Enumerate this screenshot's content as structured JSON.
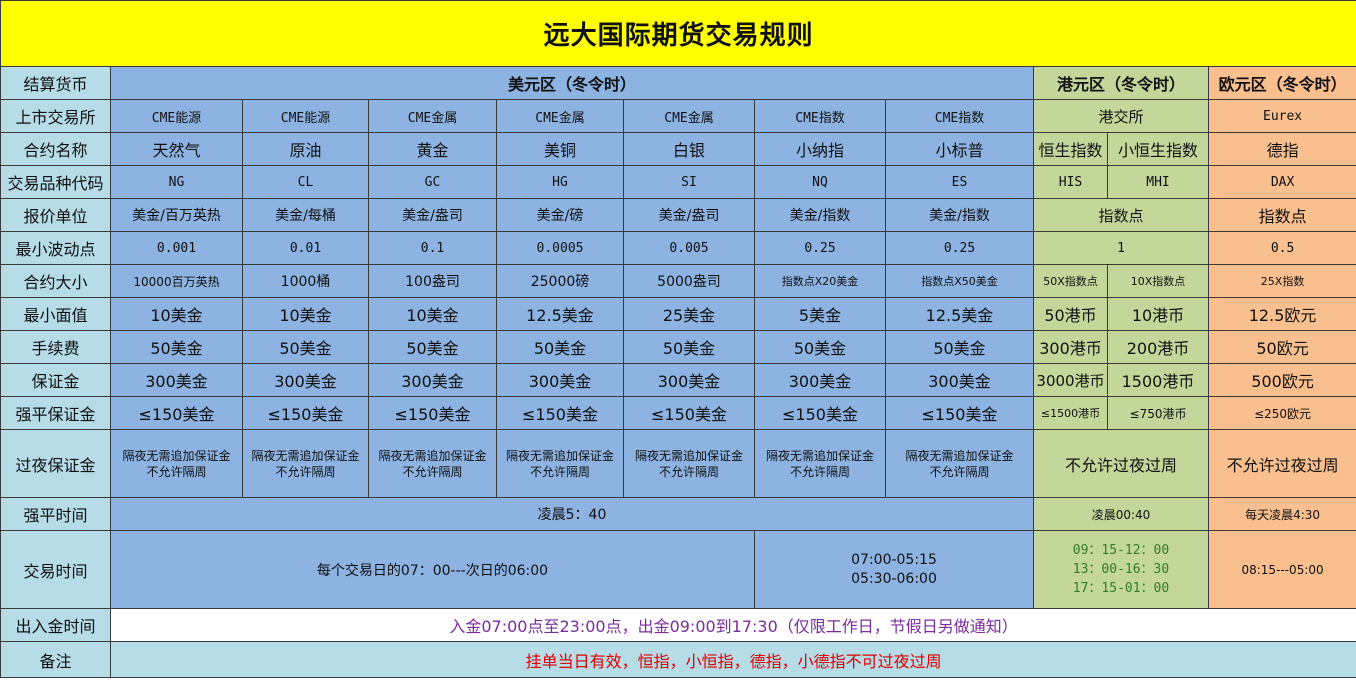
{
  "title": "远大国际期货交易规则",
  "row_labels": {
    "currency": "结算货币",
    "exchange": "上市交易所",
    "name": "合约名称",
    "code": "交易品种代码",
    "quote": "报价单位",
    "tick": "最小波动点",
    "size": "合约大小",
    "face": "最小面值",
    "fee": "手续费",
    "margin": "保证金",
    "forced": "强平保证金",
    "overnight": "过夜保证金",
    "forced_time": "强平时间",
    "trading_time": "交易时间",
    "deposit_time": "出入金时间",
    "remarks": "备注"
  },
  "regions": {
    "usd": "美元区（冬令时）",
    "hkd": "港元区（冬令时）",
    "eur": "欧元区（冬令时）"
  },
  "usd_products": [
    {
      "exchange": "CME能源",
      "name": "天然气",
      "code": "NG",
      "quote": "美金/百万英热",
      "tick": "0.001",
      "size": "10000百万英热",
      "face": "10美金",
      "fee": "50美金",
      "margin": "300美金",
      "forced": "≤150美金",
      "overnight_1": "隔夜无需追加保证金",
      "overnight_2": "不允许隔周"
    },
    {
      "exchange": "CME能源",
      "name": "原油",
      "code": "CL",
      "quote": "美金/每桶",
      "tick": "0.01",
      "size": "1000桶",
      "face": "10美金",
      "fee": "50美金",
      "margin": "300美金",
      "forced": "≤150美金",
      "overnight_1": "隔夜无需追加保证金",
      "overnight_2": "不允许隔周"
    },
    {
      "exchange": "CME金属",
      "name": "黄金",
      "code": "GC",
      "quote": "美金/盎司",
      "tick": "0.1",
      "size": "100盎司",
      "face": "10美金",
      "fee": "50美金",
      "margin": "300美金",
      "forced": "≤150美金",
      "overnight_1": "隔夜无需追加保证金",
      "overnight_2": "不允许隔周"
    },
    {
      "exchange": "CME金属",
      "name": "美铜",
      "code": "HG",
      "quote": "美金/磅",
      "tick": "0.0005",
      "size": "25000磅",
      "face": "12.5美金",
      "fee": "50美金",
      "margin": "300美金",
      "forced": "≤150美金",
      "overnight_1": "隔夜无需追加保证金",
      "overnight_2": "不允许隔周"
    },
    {
      "exchange": "CME金属",
      "name": "白银",
      "code": "SI",
      "quote": "美金/盎司",
      "tick": "0.005",
      "size": "5000盎司",
      "face": "25美金",
      "fee": "50美金",
      "margin": "300美金",
      "forced": "≤150美金",
      "overnight_1": "隔夜无需追加保证金",
      "overnight_2": "不允许隔周"
    },
    {
      "exchange": "CME指数",
      "name": "小纳指",
      "code": "NQ",
      "quote": "美金/指数",
      "tick": "0.25",
      "size": "指数点X20美金",
      "face": "5美金",
      "fee": "50美金",
      "margin": "300美金",
      "forced": "≤150美金",
      "overnight_1": "隔夜无需追加保证金",
      "overnight_2": "不允许隔周"
    },
    {
      "exchange": "CME指数",
      "name": "小标普",
      "code": "ES",
      "quote": "美金/指数",
      "tick": "0.25",
      "size": "指数点X50美金",
      "face": "12.5美金",
      "fee": "50美金",
      "margin": "300美金",
      "forced": "≤150美金",
      "overnight_1": "隔夜无需追加保证金",
      "overnight_2": "不允许隔周"
    }
  ],
  "hk": {
    "exchange": "港交所",
    "products": [
      {
        "name": "恒生指数",
        "code": "HIS",
        "size": "50X指数点",
        "face": "50港币",
        "fee": "300港币",
        "margin": "3000港币",
        "forced": "≤1500港币"
      },
      {
        "name": "小恒生指数",
        "code": "MHI",
        "size": "10X指数点",
        "face": "10港币",
        "fee": "200港币",
        "margin": "1500港币",
        "forced": "≤750港币"
      }
    ],
    "quote": "指数点",
    "tick": "1",
    "overnight": "不允许过夜过周",
    "forced_time": "凌晨00:40",
    "trading_time": [
      "09：15-12：00",
      "13：00-16：30",
      "17：15-01：00"
    ]
  },
  "eu": {
    "exchange": "Eurex",
    "name": "德指",
    "code": "DAX",
    "quote": "指数点",
    "tick": "0.5",
    "size": "25X指数",
    "face": "12.5欧元",
    "fee": "50欧元",
    "margin": "500欧元",
    "forced": "≤250欧元",
    "overnight": "不允许过夜过周",
    "forced_time": "每天凌晨4:30",
    "trading_time": "08:15---05:00"
  },
  "usd_common": {
    "forced_time": "凌晨5：40",
    "trading_time_main": "每个交易日的07：00---次日的06:00",
    "trading_time_index": [
      "07:00-05:15",
      "05:30-06:00"
    ]
  },
  "deposit_text": "入金07:00点至23:00点，出金09:00到17:30（仅限工作日，节假日另做通知）",
  "remarks_text": "挂单当日有效，恒指，小恒指，德指，小德指不可过夜过周",
  "colors": {
    "title_bg": "#ffff00",
    "label_bg": "#b6dce8",
    "usd_bg": "#8db3e2",
    "hkd_bg": "#c4d79b",
    "eur_bg": "#fabf8f",
    "deposit_text": "#7b2c9c",
    "remarks_text": "#e00000"
  }
}
